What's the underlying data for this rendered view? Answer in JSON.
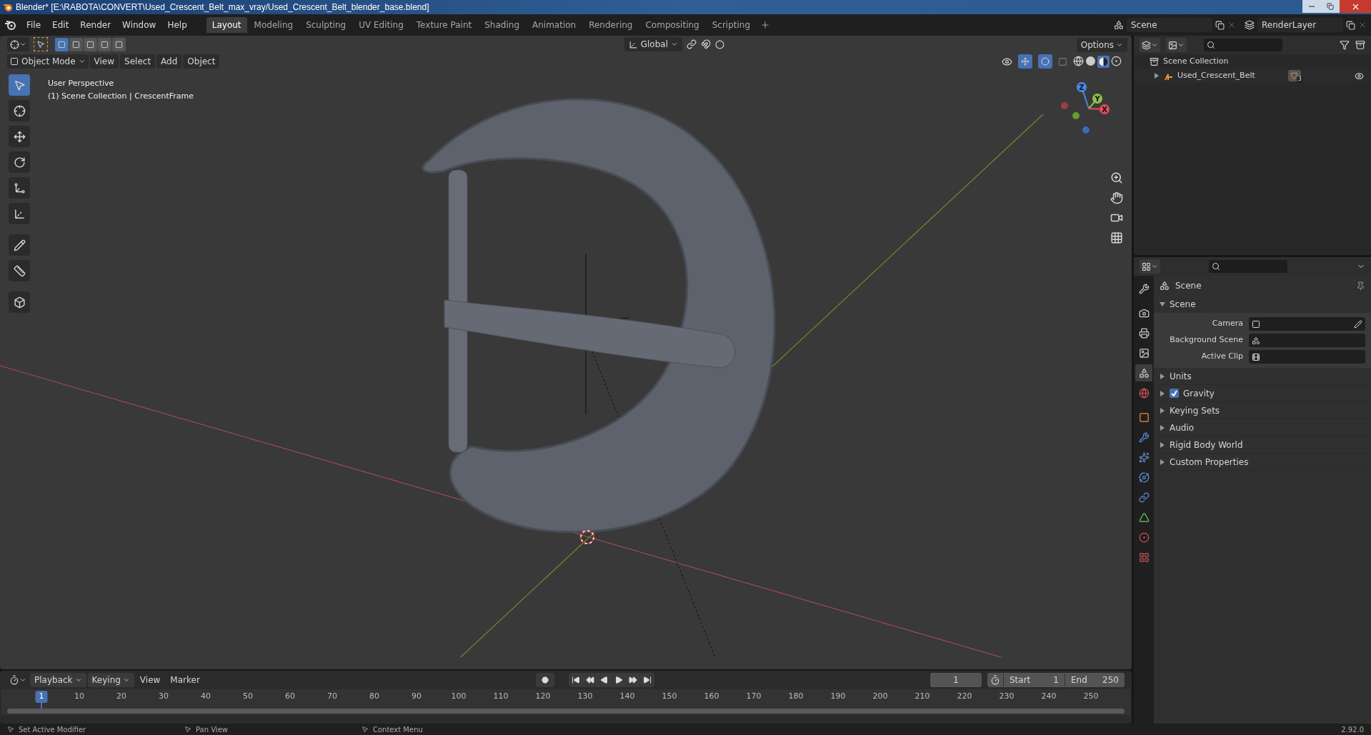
{
  "window": {
    "title": "Blender* [E:\\RABOTA\\CONVERT\\Used_Crescent_Belt_max_vray/Used_Crescent_Belt_blender_base.blend]"
  },
  "menu": [
    "File",
    "Edit",
    "Render",
    "Window",
    "Help"
  ],
  "workspaces": [
    {
      "label": "Layout",
      "selected": true
    },
    {
      "label": "Modeling",
      "selected": false
    },
    {
      "label": "Sculpting",
      "selected": false
    },
    {
      "label": "UV Editing",
      "selected": false
    },
    {
      "label": "Texture Paint",
      "selected": false
    },
    {
      "label": "Shading",
      "selected": false
    },
    {
      "label": "Animation",
      "selected": false
    },
    {
      "label": "Rendering",
      "selected": false
    },
    {
      "label": "Compositing",
      "selected": false
    },
    {
      "label": "Scripting",
      "selected": false
    }
  ],
  "scene_field": "Scene",
  "view_layer_field": "RenderLayer",
  "viewport": {
    "orientation": "Global",
    "options": "Options",
    "mode": "Object Mode",
    "menus": [
      "View",
      "Select",
      "Add",
      "Object"
    ],
    "info": [
      "User Perspective",
      "(1) Scene Collection | CrescentFrame"
    ],
    "gizmo_axes": [
      "Z",
      "Y",
      "X"
    ],
    "tools": [
      {
        "kind": "select",
        "selected": true
      },
      {
        "kind": "cursor",
        "selected": false
      },
      {
        "kind": "move",
        "selected": false
      },
      {
        "kind": "rotate",
        "selected": false
      },
      {
        "kind": "scale",
        "selected": false
      },
      {
        "kind": "transform",
        "selected": false
      },
      {
        "kind": "annotate",
        "selected": false
      },
      {
        "kind": "measure",
        "selected": false
      },
      {
        "kind": "add-cube",
        "selected": false
      }
    ]
  },
  "outliner": {
    "items": [
      {
        "label": "Scene Collection",
        "children": [
          {
            "label": "Used_Crescent_Belt",
            "expanded": false,
            "badge": "3"
          }
        ]
      }
    ]
  },
  "properties": {
    "tabs": [
      {
        "kind": "tool",
        "selected": false
      },
      {
        "kind": "render",
        "selected": false
      },
      {
        "kind": "output",
        "selected": false
      },
      {
        "kind": "view-layer",
        "selected": false
      },
      {
        "kind": "scene",
        "selected": true
      },
      {
        "kind": "world",
        "selected": false
      },
      {
        "kind": "object",
        "selected": false
      },
      {
        "kind": "modifiers",
        "selected": false
      },
      {
        "kind": "particles",
        "selected": false
      },
      {
        "kind": "physics",
        "selected": false
      },
      {
        "kind": "constraints",
        "selected": false
      },
      {
        "kind": "data",
        "selected": false
      },
      {
        "kind": "material",
        "selected": false
      },
      {
        "kind": "texture",
        "selected": false
      }
    ],
    "context": "Scene",
    "panel": {
      "title": "Scene",
      "expanded": true,
      "fields": [
        {
          "label": "Camera",
          "kind": "camera"
        },
        {
          "label": "Background Scene",
          "kind": "scene"
        },
        {
          "label": "Active Clip",
          "kind": "clip"
        }
      ]
    },
    "sections": [
      {
        "label": "Units",
        "kind": "plain",
        "expanded": false
      },
      {
        "label": "Gravity",
        "kind": "checkbox",
        "checked": true,
        "expanded": false
      },
      {
        "label": "Keying Sets",
        "kind": "plain",
        "expanded": false
      },
      {
        "label": "Audio",
        "kind": "plain",
        "expanded": false
      },
      {
        "label": "Rigid Body World",
        "kind": "plain",
        "expanded": false
      },
      {
        "label": "Custom Properties",
        "kind": "plain",
        "expanded": false
      }
    ]
  },
  "timeline": {
    "menus": [
      "Playback",
      "Keying",
      "View",
      "Marker"
    ],
    "current_frame": "1",
    "start_label": "Start",
    "start": "1",
    "end_label": "End",
    "end": "250",
    "ticks": [
      {
        "label": "1",
        "selected": true
      },
      {
        "label": "10",
        "selected": false
      },
      {
        "label": "20",
        "selected": false
      },
      {
        "label": "30",
        "selected": false
      },
      {
        "label": "40",
        "selected": false
      },
      {
        "label": "50",
        "selected": false
      },
      {
        "label": "60",
        "selected": false
      },
      {
        "label": "70",
        "selected": false
      },
      {
        "label": "80",
        "selected": false
      },
      {
        "label": "90",
        "selected": false
      },
      {
        "label": "100",
        "selected": false
      },
      {
        "label": "110",
        "selected": false
      },
      {
        "label": "120",
        "selected": false
      },
      {
        "label": "130",
        "selected": false
      },
      {
        "label": "140",
        "selected": false
      },
      {
        "label": "150",
        "selected": false
      },
      {
        "label": "160",
        "selected": false
      },
      {
        "label": "170",
        "selected": false
      },
      {
        "label": "180",
        "selected": false
      },
      {
        "label": "190",
        "selected": false
      },
      {
        "label": "200",
        "selected": false
      },
      {
        "label": "210",
        "selected": false
      },
      {
        "label": "220",
        "selected": false
      },
      {
        "label": "230",
        "selected": false
      },
      {
        "label": "240",
        "selected": false
      },
      {
        "label": "250",
        "selected": false
      }
    ]
  },
  "status_bar": [
    "Set Active Modifier",
    "Pan View",
    "Context Menu"
  ],
  "version": "2.92.0"
}
